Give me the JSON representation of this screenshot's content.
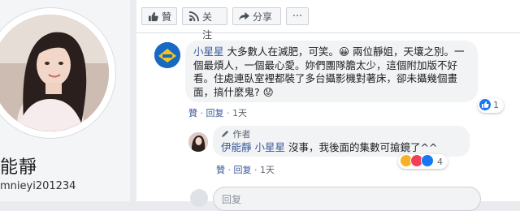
{
  "profile": {
    "name": "能靜",
    "handle": "mnieyi201234"
  },
  "actions": {
    "like": "贊",
    "follow": "关注",
    "share": "分享",
    "more": "···"
  },
  "comment": {
    "author": "小星星",
    "text": " 大多數人在減肥，可笑。😀 兩位靜姐，天壤之別。一個最煩人，一個最心愛。妳們團隊膽太少，這個附加版不好看。住處連臥室裡都裝了多台攝影機對著床，卻未攝幾個畫面，搞什麼鬼? 😟",
    "like_link": "贊",
    "reply_link": "回复",
    "time": "1天",
    "reaction_count": "1"
  },
  "reply": {
    "author_badge": "作者",
    "author": "伊能靜",
    "mention": "小星星",
    "text": " 沒事，我後面的集數可搶鏡了^^",
    "like_link": "贊",
    "reply_link": "回复",
    "time": "1天",
    "reaction_count": "4"
  },
  "compose": {
    "placeholder": "回复"
  },
  "colors": {
    "link": "#385898",
    "bubble": "#f2f3f5",
    "like_blue": "#1877f2"
  }
}
